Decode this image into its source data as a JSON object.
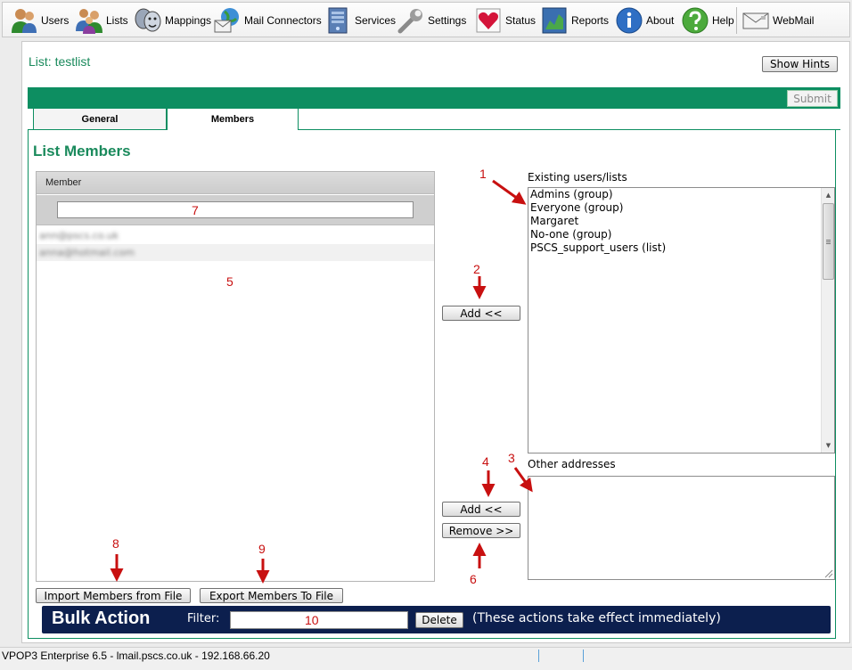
{
  "toolbar": {
    "items": [
      {
        "label": "Users",
        "icon": "users-icon"
      },
      {
        "label": "Lists",
        "icon": "lists-icon"
      },
      {
        "label": "Mappings",
        "icon": "mappings-icon"
      },
      {
        "label": "Mail Connectors",
        "icon": "mail-connectors-icon"
      },
      {
        "label": "Services",
        "icon": "services-icon"
      },
      {
        "label": "Settings",
        "icon": "settings-icon"
      },
      {
        "label": "Status",
        "icon": "status-icon"
      },
      {
        "label": "Reports",
        "icon": "reports-icon"
      },
      {
        "label": "About",
        "icon": "about-icon"
      },
      {
        "label": "Help",
        "icon": "help-icon"
      },
      {
        "label": "WebMail",
        "icon": "webmail-icon"
      }
    ]
  },
  "page": {
    "title": "List: testlist",
    "show_hints_label": "Show Hints",
    "submit_label": "Submit"
  },
  "tabs": [
    {
      "label": "General",
      "active": false
    },
    {
      "label": "Members",
      "active": true
    }
  ],
  "members": {
    "section_title": "List Members",
    "column_header": "Member",
    "filter_value": "",
    "rows": [
      "ann@pscs.co.uk",
      "anna@hotmail.com"
    ],
    "import_label": "Import Members from File",
    "export_label": "Export Members To File"
  },
  "existing": {
    "label": "Existing users/lists",
    "options": [
      "Admins (group)",
      "Everyone (group)",
      "Margaret",
      "No-one (group)",
      "PSCS_support_users (list)"
    ],
    "add_label": "Add <<"
  },
  "other": {
    "label": "Other addresses",
    "value": "",
    "add_label": "Add <<",
    "remove_label": "Remove >>"
  },
  "bulk": {
    "title": "Bulk Action",
    "filter_label": "Filter:",
    "filter_value": "",
    "delete_label": "Delete",
    "note": "(These actions take effect immediately)"
  },
  "status_bar": {
    "text": "VPOP3 Enterprise 6.5 - lmail.pscs.co.uk - 192.168.66.20"
  },
  "annotations": [
    "1",
    "2",
    "3",
    "4",
    "5",
    "6",
    "7",
    "8",
    "9",
    "10"
  ],
  "colors": {
    "accent_green": "#0d8e61",
    "title_green": "#1a8a5c",
    "bulk_bar": "#0c1f4e",
    "annotation_red": "#c81010"
  }
}
